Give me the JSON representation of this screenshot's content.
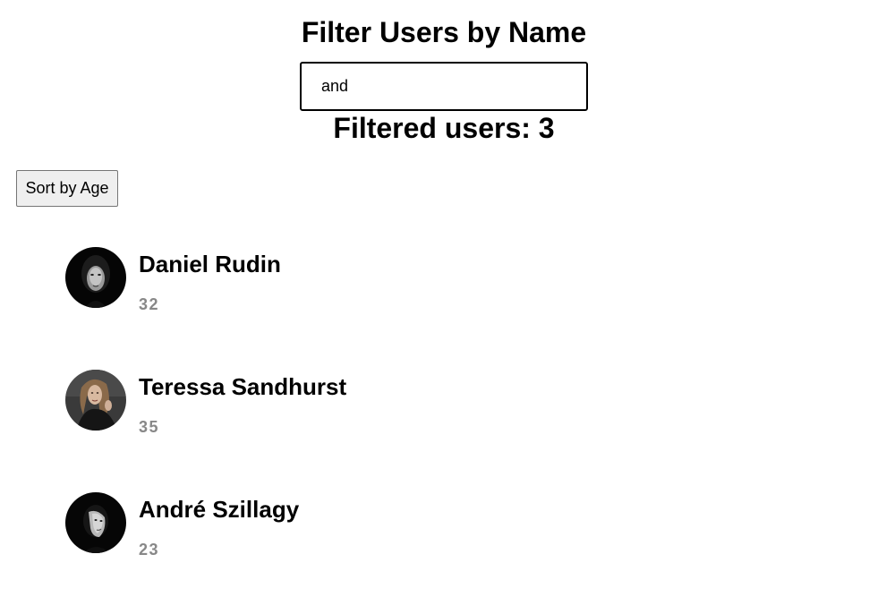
{
  "header": {
    "title": "Filter Users by Name"
  },
  "search": {
    "value": "and",
    "placeholder": ""
  },
  "results": {
    "count_label": "Filtered users: 3"
  },
  "toolbar": {
    "sort_label": "Sort by Age"
  },
  "users": [
    {
      "name": "Daniel Rudin",
      "age": "32",
      "avatar_icon": "portrait-avatar-icon"
    },
    {
      "name": "Teressa Sandhurst",
      "age": "35",
      "avatar_icon": "portrait-avatar-icon"
    },
    {
      "name": "André Szillagy",
      "age": "23",
      "avatar_icon": "portrait-avatar-icon"
    }
  ],
  "colors": {
    "text": "#000000",
    "age_text": "#888888",
    "button_bg": "#efefef",
    "button_border": "#767676"
  }
}
